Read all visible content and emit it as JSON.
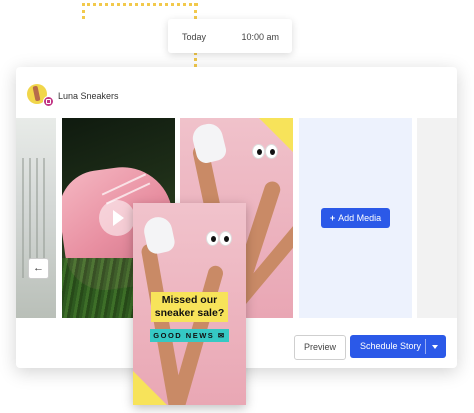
{
  "schedule": {
    "day": "Today",
    "time": "10:00 am"
  },
  "account": {
    "name": "Luna Sneakers",
    "avatar_icon": "sneaker-legs-avatar",
    "badge_icon": "instagram-icon"
  },
  "media": {
    "add_label": "Add Media",
    "add_icon": "plus-icon",
    "back_icon": "arrow-left-icon",
    "play_icon": "play-icon"
  },
  "story": {
    "headline": "Missed our sneaker sale?",
    "tagline": "GOOD NEWS",
    "tagline_icon": "mail-icon"
  },
  "actions": {
    "preview_label": "Preview",
    "schedule_label": "Schedule Story",
    "dropdown_icon": "chevron-down-icon"
  },
  "colors": {
    "accent": "#2b59e8",
    "yellow": "#f7e35a",
    "teal": "#35c9c4",
    "pink": "#e9a7b4",
    "connector": "#f2c94c"
  }
}
